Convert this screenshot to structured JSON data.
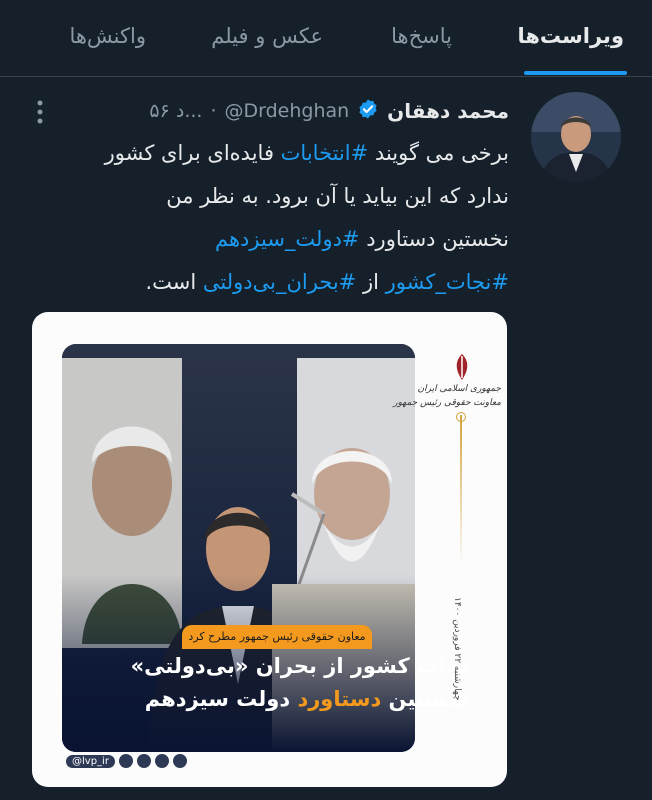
{
  "tabs": [
    {
      "label": "ویراست‌ها",
      "active": true
    },
    {
      "label": "پاسخ‌ها",
      "active": false
    },
    {
      "label": "عکس و فیلم",
      "active": false
    },
    {
      "label": "واکنش‌ها",
      "active": false
    }
  ],
  "tweet": {
    "display_name": "محمد دهقان",
    "handle": "@Drdehghan",
    "timestamp": "۵۶ د...",
    "verified": true,
    "text_lines": [
      {
        "pre": "برخی می گویند ",
        "tag": "#انتخابات",
        "post": " فایده‌ای برای کشور"
      },
      {
        "pre": "ندارد که این بیاید یا آن برود. به نظر من",
        "tag": "",
        "post": ""
      },
      {
        "pre": "نخستین دستاورد ",
        "tag": "#دولت_سیزدهم",
        "post": ""
      },
      {
        "pre": "",
        "tag": "#نجات_کشور",
        "mid": " از ",
        "tag2": "#بحران_بی‌دولتی",
        "post": "  است."
      }
    ]
  },
  "media": {
    "banner_label": "معاون حقوقی رئیس جمهور مطرح کرد",
    "headline_line1": "نجات کشور از بحران «بی‌دولتی»",
    "headline_line2_pre": "نخستین ",
    "headline_line2_highlight": "دستاورد",
    "headline_line2_post": " دولت سیزدهم",
    "org_line1": "جمهوری اسلامی ایران",
    "org_line2": "معاونت حقوقی رئیس جمهور",
    "side_vertical_text": "چهارشنبه ۲۲ فروردین ۱۴۰۰",
    "social_handle": "@lvp_ir"
  },
  "colors": {
    "background": "#15202b",
    "accent": "#1d9bf0",
    "text_primary": "#e7e9ea",
    "text_secondary": "#8b98a5",
    "banner_orange": "#f39a1e"
  },
  "icons": [
    "verified-badge-icon",
    "more-options-icon",
    "iran-emblem-icon"
  ]
}
